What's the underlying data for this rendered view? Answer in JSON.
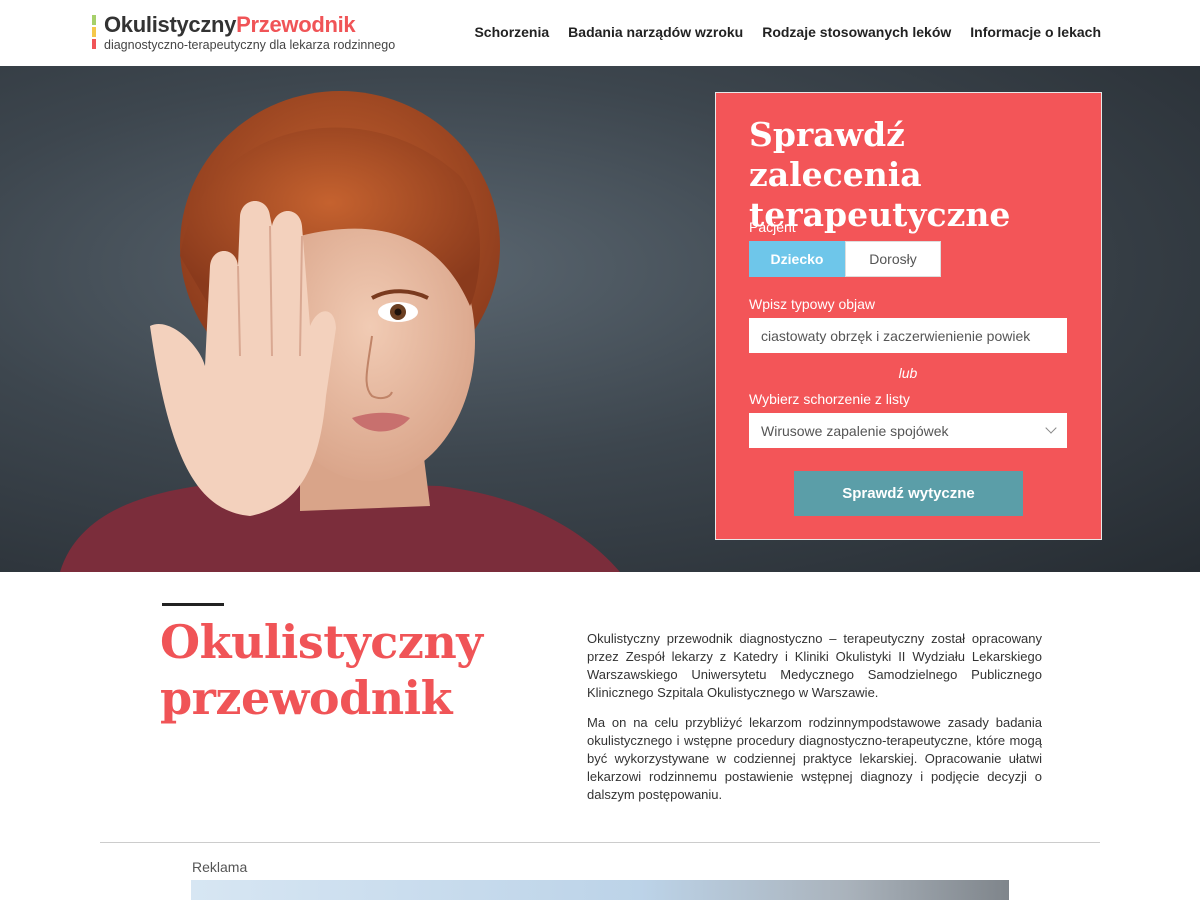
{
  "header": {
    "logo_part1": "Okulistyczny",
    "logo_part2": "Przewodnik",
    "logo_subtitle": "diagnostyczno-terapeutyczny dla lekarza rodzinnego",
    "logo_bar_colors": [
      "#a6d06a",
      "#f5c84b",
      "#f05457"
    ],
    "nav": [
      "Schorzenia",
      "Badania narządów wzroku",
      "Rodzaje stosowanych leków",
      "Informacje o lekach"
    ]
  },
  "form": {
    "title": "Sprawdź zalecenia terapeutyczne",
    "patient_label": "Pacjent",
    "toggle_child": "Dziecko",
    "toggle_adult": "Dorosły",
    "symptom_label": "Wpisz typowy objaw",
    "symptom_value": "ciastowaty obrzęk i zaczerwienienie powiek",
    "or_label": "lub",
    "disease_label": "Wybierz schorzenie z listy",
    "disease_value": "Wirusowe zapalenie spojówek",
    "submit_label": "Sprawdź wytyczne",
    "accent_color": "#f35558",
    "button_color": "#5b9ea8",
    "active_toggle_color": "#6ec6ea"
  },
  "intro": {
    "title_line1": "Okulistyczny",
    "title_line2": "przewodnik",
    "paragraph1": "Okulistyczny przewodnik diagnostyczno – terapeutyczny został opracowany przez Zespół lekarzy z Katedry i Kliniki Okulistyki II Wydziału Lekarskiego Warszawskiego Uniwersytetu Medycznego Samodzielnego Publicznego Klinicznego Szpitala Okulistycznego w Warszawie.",
    "paragraph2": "Ma on na celu przybliżyć lekarzom rodzinnympodstawowe zasady badania okulistycznego i wstępne procedury diagnostyczno-terapeutyczne, które mogą być wykorzystywane w codziennej praktyce lekarskiej. Opracowanie ułatwi lekarzowi rodzinnemu postawienie wstępnej diagnozy i podjęcie decyzji o dalszym postępowaniu."
  },
  "ad": {
    "label": "Reklama"
  }
}
